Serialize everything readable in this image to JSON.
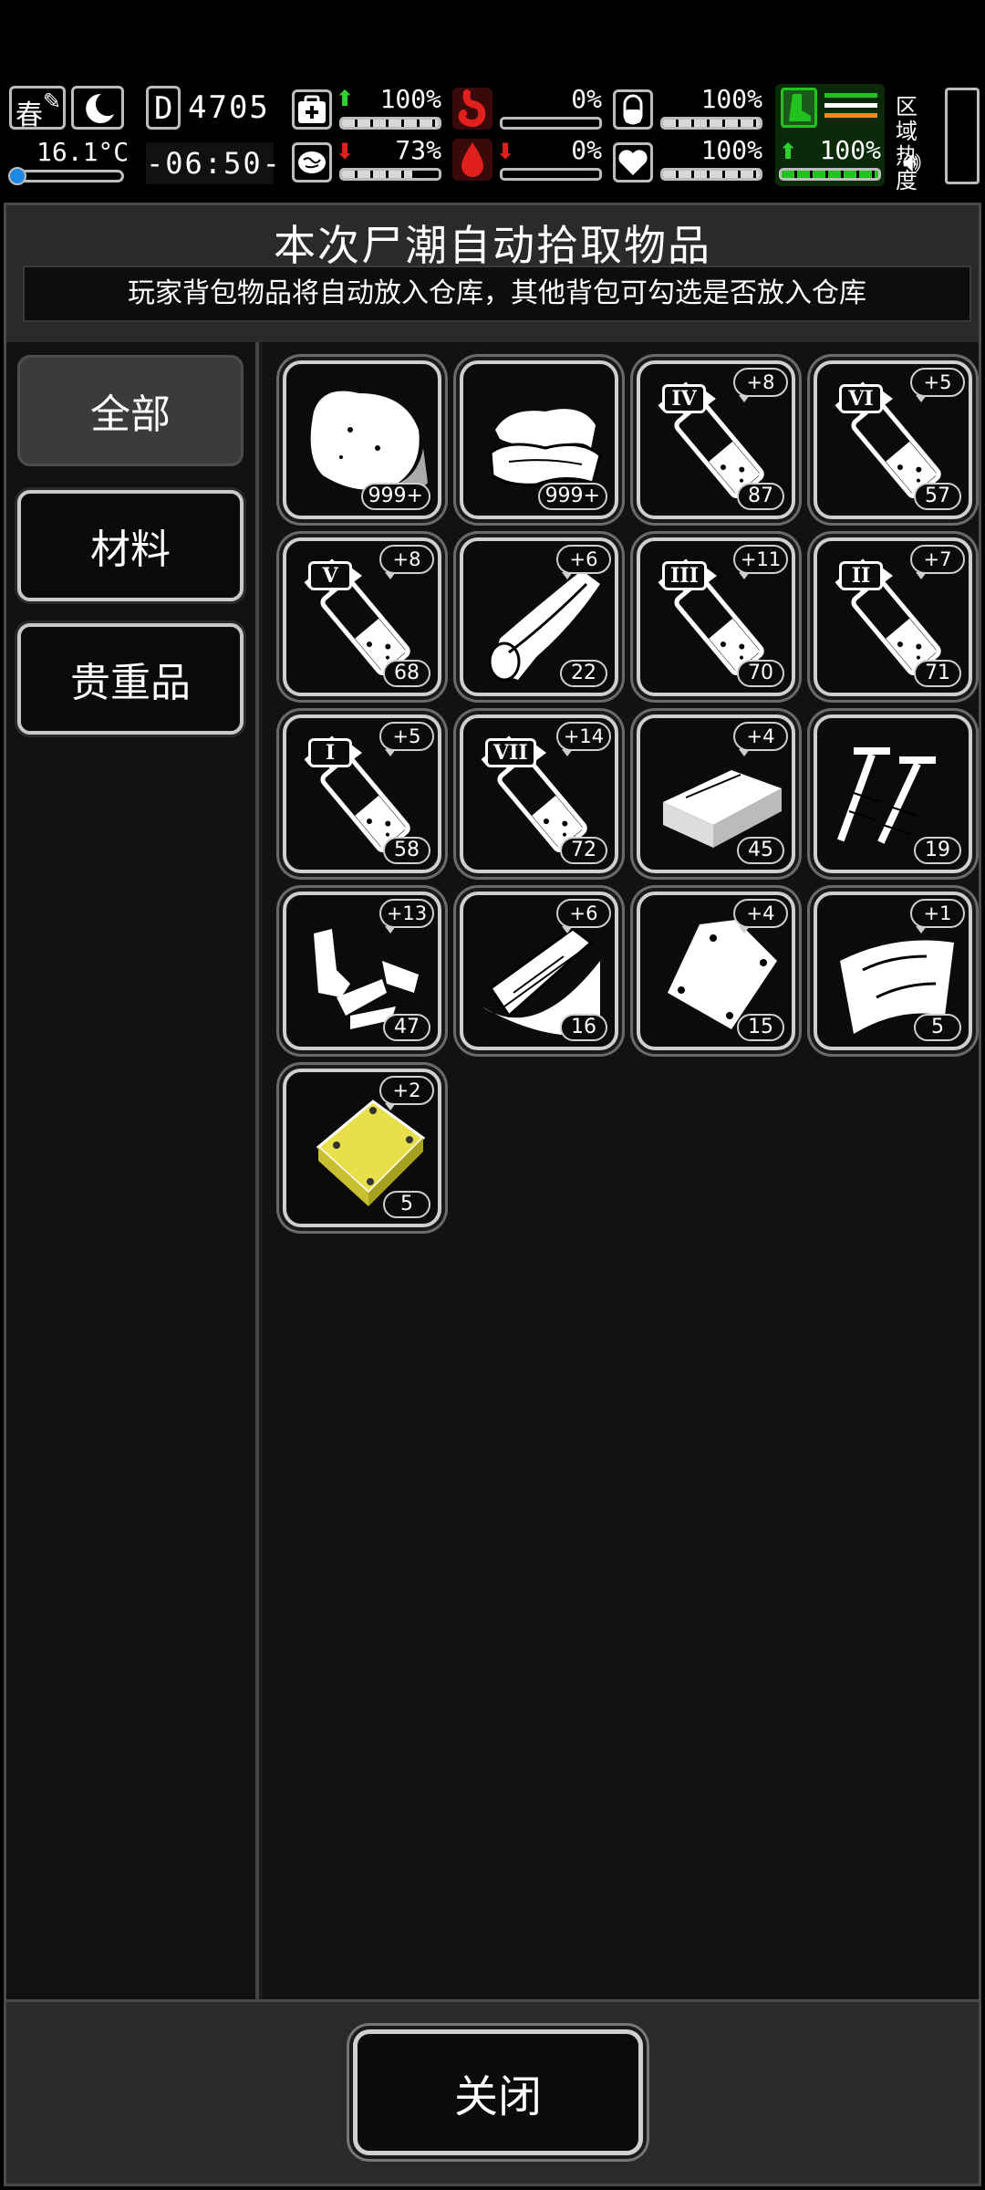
{
  "hud": {
    "season": "春",
    "temperature": "16.1°C",
    "day_counter": "4705",
    "time": "-06:50-",
    "stats": [
      {
        "icon": "first-aid-icon",
        "direction": "up",
        "value": "100%",
        "level": 1.0
      },
      {
        "icon": "stomach-icon",
        "direction": "",
        "value": "0%",
        "level": 0.0
      },
      {
        "icon": "pill-icon",
        "direction": "",
        "value": "100%",
        "level": 1.0
      },
      {
        "icon": "brain-icon",
        "direction": "down",
        "value": "73%",
        "level": 0.73
      },
      {
        "icon": "blood-drop-icon",
        "direction": "down",
        "value": "0%",
        "level": 0.0
      },
      {
        "icon": "heart-icon",
        "direction": "",
        "value": "100%",
        "level": 1.0
      }
    ],
    "stamina": {
      "direction": "up",
      "value": "100%",
      "level": 1.0
    },
    "zone_heat_label": "区域\n热度"
  },
  "panel": {
    "title": "本次尸潮自动拾取物品",
    "subtitle": "玩家背包物品将自动放入仓库，其他背包可勾选是否放入仓库"
  },
  "tabs": [
    {
      "label": "全部",
      "active": true
    },
    {
      "label": "材料",
      "active": false
    },
    {
      "label": "贵重品",
      "active": false
    }
  ],
  "items": [
    {
      "icon": "meat-icon",
      "qty": "999+",
      "bonus": ""
    },
    {
      "icon": "cloth-icon",
      "qty": "999+",
      "bonus": ""
    },
    {
      "icon": "syringe-icon",
      "roman": "IV",
      "qty": "87",
      "bonus": "+8"
    },
    {
      "icon": "syringe-icon",
      "roman": "VI",
      "qty": "57",
      "bonus": "+5"
    },
    {
      "icon": "syringe-icon",
      "roman": "V",
      "qty": "68",
      "bonus": "+8"
    },
    {
      "icon": "leather-roll-icon",
      "qty": "22",
      "bonus": "+6"
    },
    {
      "icon": "syringe-icon",
      "roman": "III",
      "qty": "70",
      "bonus": "+11"
    },
    {
      "icon": "syringe-icon",
      "roman": "II",
      "qty": "71",
      "bonus": "+7"
    },
    {
      "icon": "syringe-icon",
      "roman": "I",
      "qty": "58",
      "bonus": "+5"
    },
    {
      "icon": "syringe-icon",
      "roman": "VII",
      "qty": "72",
      "bonus": "+14"
    },
    {
      "icon": "brick-icon",
      "qty": "45",
      "bonus": "+4"
    },
    {
      "icon": "screws-icon",
      "qty": "19",
      "bonus": ""
    },
    {
      "icon": "scrap-pieces-icon",
      "qty": "47",
      "bonus": "+13"
    },
    {
      "icon": "wood-planks-icon",
      "qty": "16",
      "bonus": "+6"
    },
    {
      "icon": "metal-plate-icon",
      "qty": "15",
      "bonus": "+4"
    },
    {
      "icon": "glass-pane-icon",
      "qty": "5",
      "bonus": "+1"
    },
    {
      "icon": "gold-plate-icon",
      "qty": "5",
      "bonus": "+2"
    }
  ],
  "footer": {
    "close_label": "关闭"
  },
  "colors": {
    "accent_green": "#22c21f",
    "alert_red": "#e0201c",
    "gold": "#e8e04a"
  }
}
